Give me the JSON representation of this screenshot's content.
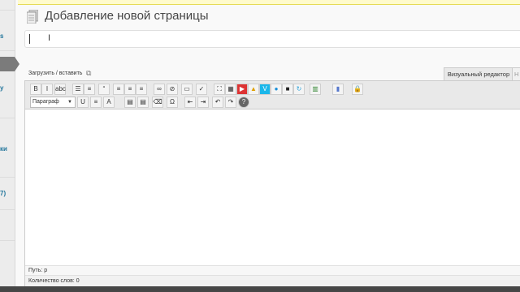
{
  "sidebar": {
    "items": [
      {
        "label": "s"
      },
      {
        "label": "у"
      },
      {
        "label": "ки"
      },
      {
        "label": "7)"
      }
    ]
  },
  "header": {
    "title": "Добавление новой страницы"
  },
  "title_field": {
    "value": ""
  },
  "media": {
    "upload_label": "Загрузить / вставить"
  },
  "editor_tabs": {
    "visual": "Визуальный редактор",
    "html": "H"
  },
  "toolbar": {
    "row1": [
      {
        "name": "bold-icon",
        "glyph": "B"
      },
      {
        "name": "italic-icon",
        "glyph": "I"
      },
      {
        "name": "strikethrough-icon",
        "glyph": "abc"
      },
      {
        "name": "bullet-list-icon",
        "glyph": "☰"
      },
      {
        "name": "numbered-list-icon",
        "glyph": "≡"
      },
      {
        "name": "blockquote-icon",
        "glyph": "“"
      },
      {
        "name": "align-left-icon",
        "glyph": "≡"
      },
      {
        "name": "align-center-icon",
        "glyph": "≡"
      },
      {
        "name": "align-right-icon",
        "glyph": "≡"
      },
      {
        "name": "link-icon",
        "glyph": "∞"
      },
      {
        "name": "unlink-icon",
        "glyph": "⊘"
      },
      {
        "name": "more-tag-icon",
        "glyph": "▭"
      },
      {
        "name": "spellcheck-icon",
        "glyph": "✓"
      },
      {
        "name": "fullscreen-icon",
        "glyph": "⛶"
      },
      {
        "name": "kitchen-sink-icon",
        "glyph": "▦"
      },
      {
        "name": "youtube-icon",
        "glyph": "▶"
      },
      {
        "name": "warning-icon",
        "glyph": "▲"
      },
      {
        "name": "vimeo-icon",
        "glyph": "V"
      },
      {
        "name": "globe-icon",
        "glyph": "●"
      },
      {
        "name": "video-icon",
        "glyph": "■"
      },
      {
        "name": "refresh-icon",
        "glyph": "↻"
      },
      {
        "name": "table-icon",
        "glyph": "▥"
      },
      {
        "name": "chart-icon",
        "glyph": "▮"
      },
      {
        "name": "lock-icon",
        "glyph": "🔒"
      }
    ],
    "format_select": "Параграф",
    "row2": [
      {
        "name": "underline-icon",
        "glyph": "U"
      },
      {
        "name": "justify-icon",
        "glyph": "≡"
      },
      {
        "name": "text-color-icon",
        "glyph": "A"
      },
      {
        "name": "paste-text-icon",
        "glyph": "▤"
      },
      {
        "name": "paste-word-icon",
        "glyph": "▤"
      },
      {
        "name": "clear-formatting-icon",
        "glyph": "⌫"
      },
      {
        "name": "special-char-icon",
        "glyph": "Ω"
      },
      {
        "name": "outdent-icon",
        "glyph": "⇤"
      },
      {
        "name": "indent-icon",
        "glyph": "⇥"
      },
      {
        "name": "undo-icon",
        "glyph": "↶"
      },
      {
        "name": "redo-icon",
        "glyph": "↷"
      },
      {
        "name": "help-icon",
        "glyph": "?"
      }
    ]
  },
  "status": {
    "path_label": "Путь: p",
    "word_count": "Количество слов: 0"
  },
  "colors": {
    "sidebar_link": "#21759b",
    "notice_bg": "#fffbcc",
    "toolbar_bg": "#e9e9e9"
  }
}
